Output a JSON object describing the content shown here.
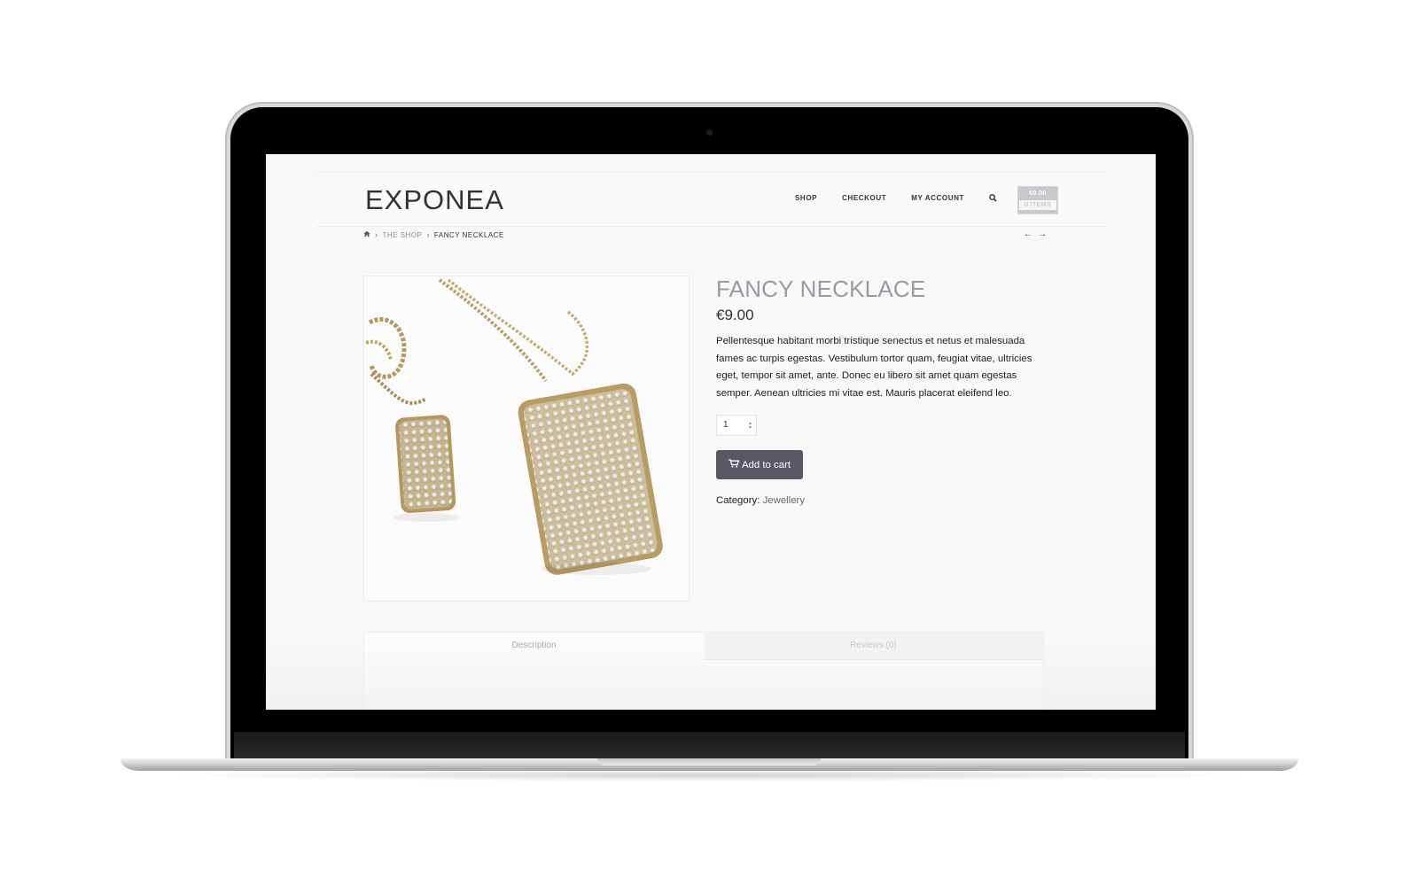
{
  "site": {
    "logo": "EXPONEA",
    "nav": [
      "SHOP",
      "CHECKOUT",
      "MY ACCOUNT"
    ],
    "cart": {
      "total": "€0.00",
      "items": "0 ITEMS"
    }
  },
  "breadcrumb": {
    "shop": "THE SHOP",
    "current": "FANCY NECKLACE"
  },
  "product": {
    "title": "FANCY NECKLACE",
    "price": "€9.00",
    "description": "Pellentesque habitant morbi tristique senectus et netus et malesuada fames ac turpis egestas. Vestibulum tortor quam, feugiat vitae, ultricies eget, tempor sit amet, ante. Donec eu libero sit amet quam egestas semper. Aenean ultricies mi vitae est. Mauris placerat eleifend leo.",
    "quantity": "1",
    "add_to_cart": "Add to cart",
    "category_label": "Category:",
    "category_value": "Jewellery"
  },
  "tabs": {
    "description": "Description",
    "reviews": "Reviews (0)"
  },
  "colors": {
    "button": "#5b5766",
    "title": "#9a9aa2",
    "device": "#000000"
  }
}
